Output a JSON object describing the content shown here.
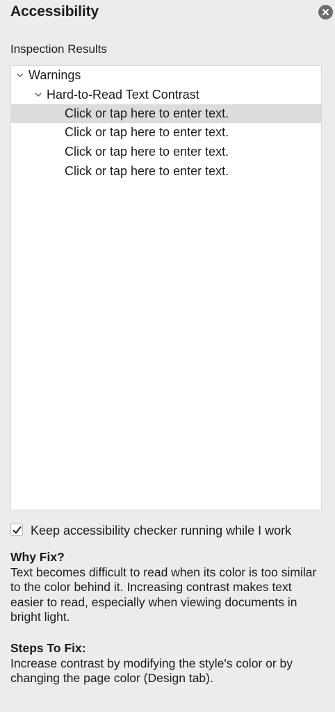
{
  "pane": {
    "title": "Accessibility",
    "close_icon": "close-circle-icon"
  },
  "inspection": {
    "label": "Inspection Results",
    "tree": {
      "category": "Warnings",
      "issue": "Hard-to-Read Text Contrast",
      "items": [
        "Click or tap here to enter text.",
        "Click or tap here to enter text.",
        "Click or tap here to enter text.",
        "Click or tap here to enter text."
      ],
      "selected_index": 0
    }
  },
  "options": {
    "keep_running_label": "Keep accessibility checker running while I work",
    "keep_running_checked": true
  },
  "why_fix": {
    "heading": "Why Fix?",
    "body": "Text becomes difficult to read when its color is too similar to the color behind it. Increasing contrast makes text easier to read, especially when viewing documents in bright light."
  },
  "steps_to_fix": {
    "heading": "Steps To Fix:",
    "body": "Increase contrast by modifying the style's color or by changing the page color (Design tab)."
  },
  "colors": {
    "background": "#ececec",
    "selection": "#dcdcdc",
    "close_button": "#6d6d6d"
  }
}
